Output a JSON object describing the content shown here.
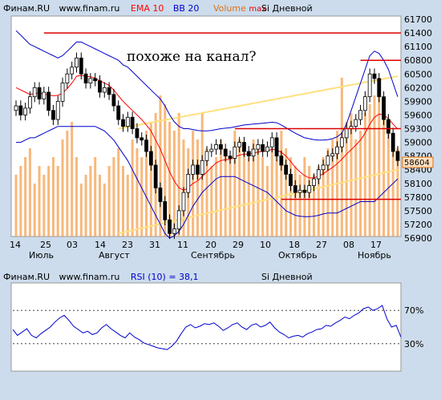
{
  "header": {
    "brand": "Финам.RU",
    "site": "www.finam.ru",
    "ema": "EMA 10",
    "bb": "BB 20",
    "volume": "Volume",
    "max": "max",
    "ticker": "Si Дневной"
  },
  "annotation": "похоже на канал?",
  "last_price": "58604",
  "rsi_header": {
    "brand": "Финам.RU",
    "site": "www.finam.ru",
    "rsi": "RSI (10) = 38,1",
    "ticker": "Si Дневной"
  },
  "colors": {
    "background": "#ccdcec",
    "plot": "#ffffff",
    "ema": "#ff0000",
    "bb": "#0000cc",
    "volume": "#f5a050",
    "rsi": "#0000cc",
    "trend_lines": "#ffe080",
    "levels": "#dd0000"
  },
  "chart_data": [
    {
      "type": "candlestick",
      "title": "Si Дневной",
      "ylim": [
        56900,
        61700
      ],
      "y_ticks": [
        "61700",
        "61400",
        "61100",
        "60800",
        "60500",
        "60200",
        "59900",
        "59600",
        "59300",
        "59000",
        "58700",
        "58400",
        "58100",
        "57800",
        "57500",
        "57200",
        "56900"
      ],
      "x_ticks": [
        "14",
        "25",
        "03",
        "14",
        "23",
        "31",
        "11",
        "20",
        "29",
        "10",
        "18",
        "27",
        "08",
        "17"
      ],
      "months": [
        "Июль",
        "Август",
        "Сентябрь",
        "Октябрь",
        "Ноябрь"
      ],
      "close": [
        59800,
        59600,
        59750,
        60000,
        60200,
        59950,
        60100,
        59700,
        59500,
        59900,
        60300,
        60500,
        60650,
        60850,
        60500,
        60300,
        60400,
        60350,
        60100,
        60200,
        60050,
        59800,
        59500,
        59350,
        59550,
        59300,
        59100,
        59050,
        58800,
        58500,
        58000,
        57700,
        57300,
        57000,
        57100,
        57500,
        57900,
        58300,
        58500,
        58300,
        58600,
        58800,
        58850,
        58950,
        58850,
        58700,
        58650,
        58900,
        59000,
        58800,
        58700,
        58850,
        58950,
        58800,
        58900,
        59100,
        58700,
        58500,
        58300,
        58050,
        57900,
        57950,
        57900,
        58050,
        58200,
        58400,
        58500,
        58700,
        58750,
        58900,
        59100,
        59300,
        59350,
        59500,
        59700,
        60000,
        60500,
        60400,
        60000,
        59500,
        59200,
        58800,
        58600
      ],
      "ema10": [
        60200,
        60150,
        60100,
        60050,
        60070,
        60080,
        60060,
        60040,
        60020,
        60030,
        60080,
        60180,
        60300,
        60450,
        60470,
        60450,
        60440,
        60410,
        60350,
        60300,
        60250,
        60150,
        60020,
        59900,
        59800,
        59700,
        59600,
        59500,
        59380,
        59250,
        59050,
        58850,
        58600,
        58350,
        58150,
        58000,
        57950,
        58000,
        58100,
        58150,
        58250,
        58350,
        58450,
        58550,
        58600,
        58620,
        58630,
        58680,
        58720,
        58740,
        58740,
        58760,
        58790,
        58800,
        58810,
        58850,
        58830,
        58780,
        58700,
        58580,
        58450,
        58350,
        58270,
        58220,
        58220,
        58260,
        58310,
        58380,
        58450,
        58530,
        58630,
        58740,
        58840,
        58940,
        59050,
        59200,
        59400,
        59550,
        59620,
        59600,
        59520,
        59400,
        59290
      ],
      "bb_upper": [
        61450,
        61350,
        61250,
        61150,
        61100,
        61050,
        61000,
        60950,
        60900,
        60850,
        60900,
        61000,
        61100,
        61200,
        61200,
        61150,
        61100,
        61050,
        61000,
        60950,
        60900,
        60850,
        60800,
        60700,
        60650,
        60550,
        60450,
        60350,
        60250,
        60150,
        60050,
        59950,
        59800,
        59600,
        59450,
        59350,
        59300,
        59300,
        59280,
        59260,
        59250,
        59250,
        59260,
        59280,
        59300,
        59310,
        59320,
        59340,
        59360,
        59380,
        59390,
        59400,
        59410,
        59420,
        59430,
        59440,
        59430,
        59380,
        59320,
        59260,
        59200,
        59150,
        59100,
        59080,
        59060,
        59050,
        59050,
        59060,
        59080,
        59120,
        59200,
        59400,
        59700,
        60000,
        60300,
        60600,
        60900,
        61000,
        60950,
        60800,
        60600,
        60300,
        60000
      ],
      "bb_lower": [
        59000,
        59000,
        59050,
        59100,
        59100,
        59150,
        59200,
        59250,
        59300,
        59350,
        59350,
        59350,
        59350,
        59350,
        59350,
        59350,
        59350,
        59350,
        59300,
        59250,
        59150,
        59050,
        58900,
        58750,
        58600,
        58400,
        58200,
        58000,
        57800,
        57600,
        57400,
        57200,
        57000,
        56900,
        56950,
        57050,
        57200,
        57400,
        57600,
        57750,
        57900,
        58000,
        58100,
        58200,
        58250,
        58250,
        58250,
        58250,
        58200,
        58150,
        58100,
        58050,
        58000,
        57950,
        57900,
        57800,
        57700,
        57600,
        57500,
        57450,
        57400,
        57380,
        57370,
        57370,
        57380,
        57400,
        57430,
        57450,
        57450,
        57450,
        57500,
        57550,
        57600,
        57650,
        57700,
        57700,
        57700,
        57700,
        57800,
        57900,
        58000,
        58100,
        58200
      ],
      "volume": [
        0.35,
        0.4,
        0.45,
        0.5,
        0.3,
        0.4,
        0.35,
        0.4,
        0.45,
        0.4,
        0.55,
        0.6,
        0.65,
        0.45,
        0.3,
        0.35,
        0.4,
        0.45,
        0.35,
        0.3,
        0.4,
        0.45,
        0.5,
        0.4,
        0.35,
        0.55,
        0.5,
        0.45,
        0.6,
        0.65,
        0.7,
        0.8,
        0.75,
        0.65,
        0.6,
        0.7,
        0.55,
        0.5,
        0.6,
        0.55,
        0.7,
        0.5,
        0.4,
        0.45,
        0.55,
        0.5,
        0.45,
        0.6,
        0.55,
        0.5,
        0.45,
        0.55,
        0.5,
        0.45,
        0.4,
        0.5,
        0.55,
        0.6,
        0.5,
        0.45,
        0.4,
        0.35,
        0.45,
        0.4,
        0.35,
        0.4,
        0.45,
        0.5,
        0.55,
        0.6,
        0.9,
        0.65,
        0.7,
        0.55,
        0.6,
        0.7,
        0.75,
        0.8,
        0.85,
        0.7,
        0.6,
        0.55,
        0.5
      ],
      "levels": [
        61400,
        60800,
        59300,
        57750
      ],
      "trend_lines": [
        [
          59300,
          60450
        ],
        [
          57000,
          58400
        ]
      ]
    },
    {
      "type": "line",
      "title": "RSI (10) = 38,1",
      "ylim": [
        0,
        100
      ],
      "y_ticks": [
        "70%",
        "30%"
      ],
      "guides": [
        70,
        30
      ],
      "values": [
        47,
        40,
        44,
        48,
        40,
        37,
        42,
        46,
        50,
        56,
        61,
        64,
        58,
        51,
        47,
        43,
        45,
        41,
        43,
        49,
        53,
        48,
        44,
        40,
        37,
        43,
        38,
        35,
        31,
        29,
        27,
        25,
        24,
        23,
        27,
        33,
        42,
        50,
        53,
        49,
        51,
        54,
        53,
        55,
        51,
        46,
        49,
        53,
        55,
        50,
        47,
        52,
        54,
        50,
        52,
        56,
        49,
        44,
        41,
        37,
        39,
        40,
        38,
        42,
        44,
        47,
        48,
        52,
        51,
        55,
        58,
        62,
        60,
        64,
        67,
        72,
        74,
        70,
        72,
        76,
        60,
        50,
        52,
        38
      ]
    }
  ]
}
